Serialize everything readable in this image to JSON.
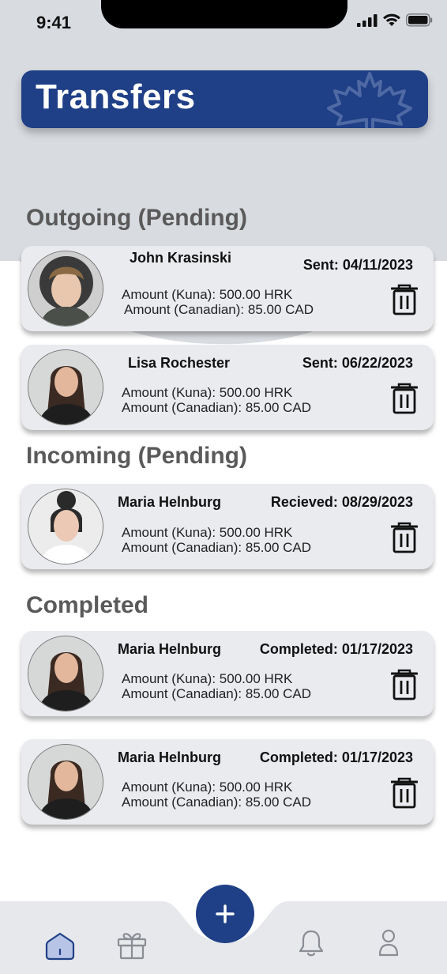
{
  "status": {
    "time": "9:41"
  },
  "header": {
    "title": "Transfers"
  },
  "sections": {
    "outgoing": "Outgoing (Pending)",
    "incoming": "Incoming (Pending)",
    "completed": "Completed"
  },
  "transfers": [
    {
      "name": "John Krasinski",
      "date": "Sent: 04/11/2023",
      "amount_kuna": "Amount (Kuna): 500.00 HRK",
      "amount_cad": "Amount (Canadian): 85.00 CAD"
    },
    {
      "name": "Lisa Rochester",
      "date": "Sent: 06/22/2023",
      "amount_kuna": "Amount (Kuna): 500.00 HRK",
      "amount_cad": "Amount (Canadian): 85.00 CAD"
    },
    {
      "name": "Maria Helnburg",
      "date": "Recieved: 08/29/2023",
      "amount_kuna": "Amount (Kuna): 500.00 HRK",
      "amount_cad": "Amount (Canadian): 85.00 CAD"
    },
    {
      "name": "Maria Helnburg",
      "date": "Completed: 01/17/2023",
      "amount_kuna": "Amount (Kuna): 500.00 HRK",
      "amount_cad": "Amount (Canadian): 85.00 CAD"
    },
    {
      "name": "Maria Helnburg",
      "date": "Completed: 01/17/2023",
      "amount_kuna": "Amount (Kuna): 500.00 HRK",
      "amount_cad": "Amount (Canadian): 85.00 CAD"
    }
  ],
  "icons": {
    "banner": "maple-leaf-icon",
    "delete": "trash-icon",
    "fab": "plus-icon",
    "nav": [
      "home-icon",
      "gift-icon",
      "bell-icon",
      "profile-icon"
    ]
  },
  "colors": {
    "brand": "#1f3f86",
    "card": "#e9ebef",
    "header_bg": "#d8dbe0"
  }
}
